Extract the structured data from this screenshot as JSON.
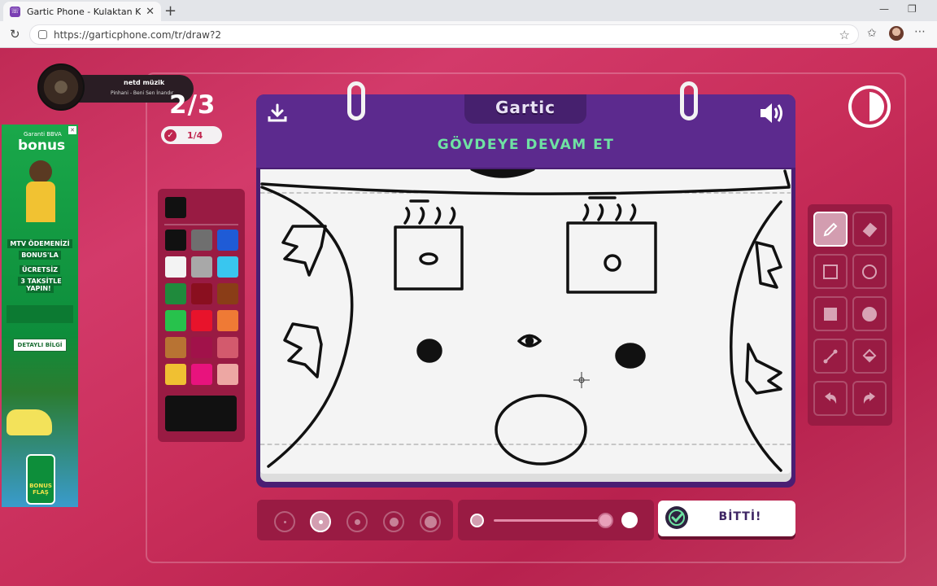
{
  "browser": {
    "tab_title": "Gartic Phone - Kulaktan Kulağa",
    "tab_close": "✕",
    "new_tab": "+",
    "url": "https://garticphone.com/tr/draw?2",
    "minimize": "—",
    "restore": "❐"
  },
  "music": {
    "title": "netd müzik",
    "subtitle": "Pinhani - Beni Sen İnandır"
  },
  "game": {
    "round": "2/3",
    "progress": "1/4",
    "logo": "Gartic",
    "prompt": "GÖVDEYE DEVAM ET",
    "done_label": "BİTTİ!",
    "timer_remaining": 0.4
  },
  "ad": {
    "brand": "Garanti BBVA",
    "bonus": "bonus",
    "line1": "MTV ÖDEMENİZİ",
    "line2": "BONUS'LA",
    "line3": "ÜCRETSİZ",
    "line4": "3 TAKSİTLE YAPIN!",
    "details_button": "DETAYLI BİLGİ",
    "flas": "BONUS FLAŞ"
  },
  "palette": {
    "current": "#111111",
    "colors": [
      "#111111",
      "#6f6f6f",
      "#1f5bd6",
      "#f3f3f3",
      "#a8a8a8",
      "#39c6ef",
      "#1f8a3c",
      "#8a0f1f",
      "#8a3d17",
      "#27c24c",
      "#e8132b",
      "#ef7a35",
      "#b87333",
      "#a1124a",
      "#d35a6d",
      "#f0c032",
      "#e8137d",
      "#eda7a3"
    ]
  },
  "colors": {
    "accent_green": "#6fe3a3",
    "board_purple": "#5c2a8e",
    "panel": "#991b43"
  }
}
